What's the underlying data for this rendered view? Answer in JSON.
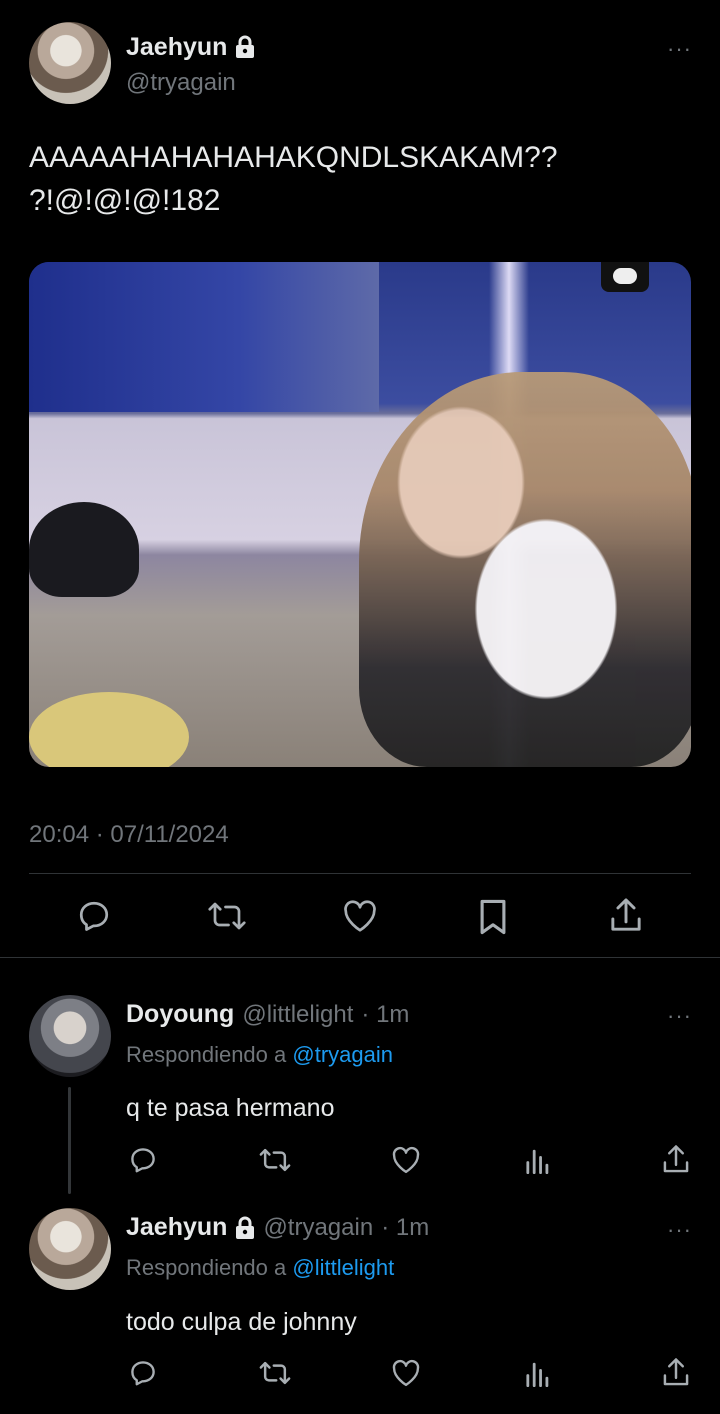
{
  "main_tweet": {
    "author_name": "Jaehyun",
    "author_handle": "@tryagain",
    "more": "···",
    "text_line1": "AAAAAHAHAHAHAKQNDLSKAKAM??",
    "text_line2": "?!@!@!@!182",
    "time": "20:04 · 07/11/2024",
    "protected_icon": "lock-icon"
  },
  "actions": [
    "reply-icon",
    "retweet-icon",
    "like-icon",
    "bookmark-icon",
    "share-icon"
  ],
  "replies": [
    {
      "author_name": "Doyoung",
      "author_handle": "@littlelight",
      "age": "· 1m",
      "replying_prefix": "Respondiendo a",
      "replying_to": "@tryagain",
      "text": "q te pasa hermano",
      "more": "···"
    },
    {
      "author_name": "Jaehyun",
      "author_handle": "@tryagain",
      "age": "· 1m",
      "replying_prefix": "Respondiendo a",
      "replying_to": "@littlelight",
      "text": "todo culpa de johnny",
      "more": "···"
    }
  ],
  "colors": {
    "background": "#000000",
    "text": "#e7e9ea",
    "secondary": "#71767b",
    "accent": "#1d9bf0",
    "divider": "#2f3336"
  }
}
